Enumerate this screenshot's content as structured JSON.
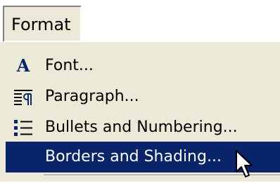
{
  "menubar": {
    "format_label": "Format"
  },
  "menu": {
    "items": [
      {
        "label": "Font...",
        "icon": "font-icon",
        "highlighted": false
      },
      {
        "label": "Paragraph...",
        "icon": "paragraph-icon",
        "highlighted": false
      },
      {
        "label": "Bullets and Numbering...",
        "icon": "bullets-icon",
        "highlighted": false
      },
      {
        "label": "Borders and Shading...",
        "icon": "",
        "highlighted": true
      }
    ]
  },
  "cursor": {
    "icon": "mouse-pointer-icon"
  },
  "colors": {
    "menu_background": "#ece9d8",
    "highlight_background": "#0a246a",
    "highlight_text": "#ffffff",
    "icon_blue": "#0a246a"
  }
}
